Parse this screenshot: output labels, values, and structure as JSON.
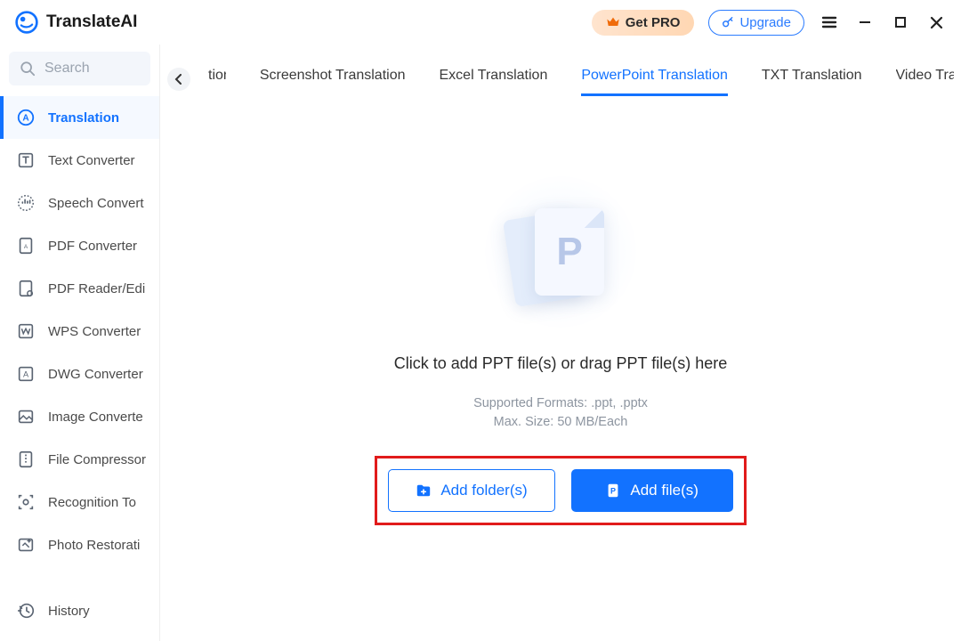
{
  "app": {
    "title": "TranslateAI"
  },
  "titlebar": {
    "getpro_label": "Get PRO",
    "upgrade_label": "Upgrade"
  },
  "search": {
    "placeholder": "Search"
  },
  "sidebar": {
    "items": [
      {
        "label": "Translation"
      },
      {
        "label": "Text Converter"
      },
      {
        "label": "Speech Convert"
      },
      {
        "label": "PDF Converter"
      },
      {
        "label": "PDF Reader/Edi"
      },
      {
        "label": "WPS Converter"
      },
      {
        "label": "DWG Converter"
      },
      {
        "label": "Image Converte"
      },
      {
        "label": "File Compressor"
      },
      {
        "label": "Recognition To"
      },
      {
        "label": "Photo Restorati"
      }
    ],
    "history_label": "History"
  },
  "tabs": {
    "partial_left": "tion",
    "items": [
      {
        "label": "Screenshot Translation"
      },
      {
        "label": "Excel Translation"
      },
      {
        "label": "PowerPoint Translation"
      },
      {
        "label": "TXT Translation"
      }
    ],
    "partial_right": "Video Trans"
  },
  "content": {
    "instruction": "Click to add PPT file(s) or drag PPT file(s) here",
    "formats_line": "Supported Formats: .ppt, .pptx",
    "size_line": "Max. Size: 50 MB/Each",
    "add_folder_label": "Add folder(s)",
    "add_file_label": "Add file(s)",
    "illustration_letter": "P"
  },
  "colors": {
    "accent": "#1272ff",
    "highlight_border": "#e11b1b"
  }
}
